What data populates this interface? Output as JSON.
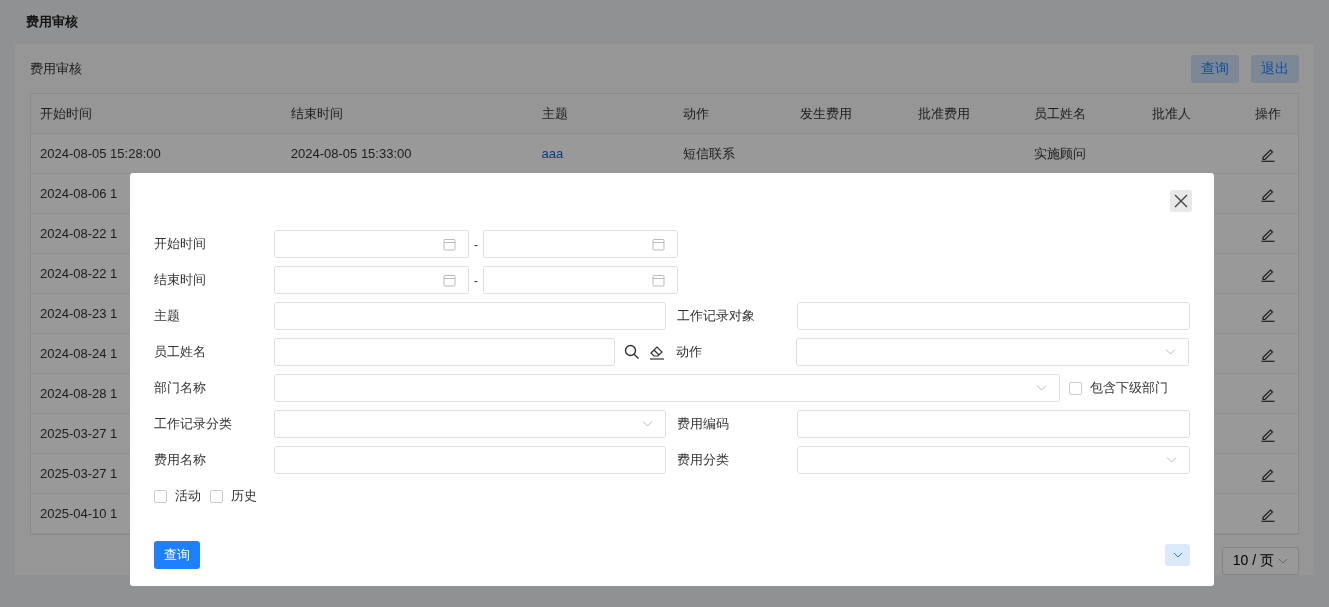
{
  "page_title": "费用审核",
  "panel": {
    "title": "费用审核",
    "buttons": [
      "查询",
      "退出"
    ]
  },
  "table": {
    "columns": [
      "开始时间",
      "结束时间",
      "主题",
      "动作",
      "发生费用",
      "批准费用",
      "员工姓名",
      "批准人",
      "操作"
    ],
    "rows": [
      {
        "start_time": "2024-08-05 15:28:00",
        "end_time": "2024-08-05 15:33:00",
        "subject": "aaa",
        "action": "短信联系",
        "employee": "实施顾问"
      },
      {
        "start_time": "2024-08-06 1"
      },
      {
        "start_time": "2024-08-22 1"
      },
      {
        "start_time": "2024-08-22 1"
      },
      {
        "start_time": "2024-08-23 1"
      },
      {
        "start_time": "2024-08-24 1"
      },
      {
        "start_time": "2024-08-28 1"
      },
      {
        "start_time": "2025-03-27 1"
      },
      {
        "start_time": "2025-03-27 1"
      },
      {
        "start_time": "2025-04-10 1"
      }
    ]
  },
  "pagination": {
    "page_size": "10 / 页"
  },
  "dialog": {
    "rows": [
      [
        {
          "kind": "date_range",
          "label": "开始时间",
          "separator": "-"
        }
      ],
      [
        {
          "kind": "date_range",
          "label": "结束时间",
          "separator": "-"
        }
      ],
      [
        {
          "kind": "text",
          "label": "主题"
        },
        {
          "kind": "text",
          "label": "工作记录对象"
        }
      ],
      [
        {
          "kind": "lookup",
          "label": "员工姓名"
        },
        {
          "kind": "select",
          "label": "动作"
        }
      ],
      [
        {
          "kind": "select_wide",
          "label": "部门名称",
          "option": {
            "label": "包含下级部门",
            "checked": false
          }
        }
      ],
      [
        {
          "kind": "select",
          "label": "工作记录分类"
        },
        {
          "kind": "text",
          "label": "费用编码"
        }
      ],
      [
        {
          "kind": "text",
          "label": "费用名称"
        },
        {
          "kind": "select",
          "label": "费用分类"
        }
      ]
    ],
    "checkboxes": [
      {
        "label": "活动",
        "checked": false
      },
      {
        "label": "历史",
        "checked": false
      }
    ],
    "search_button": "查询"
  }
}
